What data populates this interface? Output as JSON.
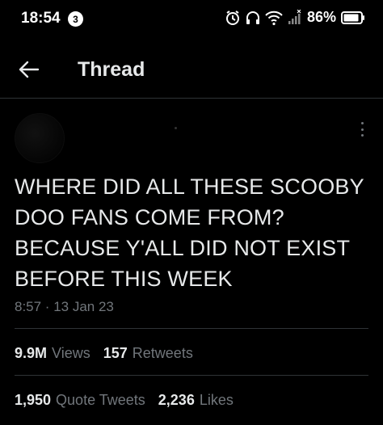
{
  "status_bar": {
    "time": "18:54",
    "notification_count": "3",
    "battery": "86%"
  },
  "header": {
    "title": "Thread"
  },
  "tweet": {
    "text_lines": [
      "WHERE DID ALL THESE SCOOBY",
      "DOO FANS COME FROM?",
      "BECAUSE Y'ALL DID NOT EXIST",
      "BEFORE THIS WEEK"
    ],
    "timestamp": "8:57 · 13 Jan 23"
  },
  "stats": {
    "views": {
      "value": "9.9M",
      "label": "Views"
    },
    "retweets": {
      "value": "157",
      "label": "Retweets"
    },
    "quote_tweets": {
      "value": "1,950",
      "label": "Quote Tweets"
    },
    "likes": {
      "value": "2,236",
      "label": "Likes"
    }
  },
  "colors": {
    "background": "#000000",
    "text_primary": "#e7e9ea",
    "text_secondary": "#71767b",
    "divider": "#2f3336"
  }
}
